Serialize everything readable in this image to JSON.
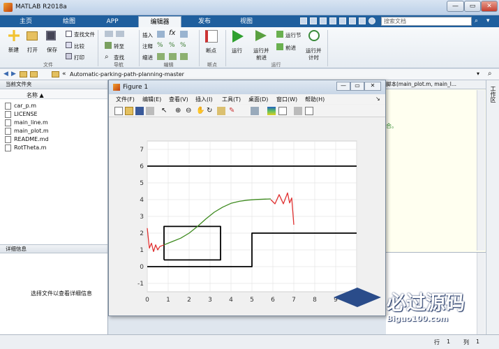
{
  "window": {
    "title": "MATLAB R2018a",
    "min": "—",
    "max": "▭",
    "close": "✕"
  },
  "tabs": [
    {
      "label": "主页"
    },
    {
      "label": "绘图"
    },
    {
      "label": "APP"
    },
    {
      "label": "编辑器"
    },
    {
      "label": "发布"
    },
    {
      "label": "视图"
    }
  ],
  "search": {
    "placeholder": "搜索文档"
  },
  "ribbon": {
    "new": "新建",
    "open": "打开",
    "save": "保存",
    "find_files": "查找文件",
    "compare": "比较",
    "print": "打印",
    "goto": "转至",
    "find": "查找",
    "insert": "插入",
    "comment": "注释",
    "indent": "缩进",
    "breakpoints": "断点",
    "run": "运行",
    "run_advance": "运行并",
    "run_advance2": "前进",
    "run_section": "运行节",
    "advance": "前进",
    "run_time": "运行并",
    "run_time2": "计时",
    "groups": {
      "file": "文件",
      "navigate": "导航",
      "edit": "编辑",
      "breakpoints": "断点",
      "run": "运行"
    }
  },
  "path": {
    "text": "Automatic-parking-path-planning-master"
  },
  "current_folder": {
    "title": "当前文件夹",
    "name_col": "名称 ▲",
    "files": [
      {
        "name": "car_p.m"
      },
      {
        "name": "LICENSE"
      },
      {
        "name": "main_line.m"
      },
      {
        "name": "main_plot.m"
      },
      {
        "name": "README.md"
      },
      {
        "name": "RotTheta.m"
      }
    ]
  },
  "details": {
    "title": "详细信息",
    "hint": "选择文件以查看详细信息"
  },
  "editor": {
    "tabs_text": "脚本(main_plot.m, main_l...",
    " snippet": "合。",
    "snippet": "合。"
  },
  "workspace_label": "工作区",
  "status": {
    "line_label": "行",
    "line": "1",
    "col_label": "列",
    "col": "1"
  },
  "figure": {
    "title": "Figure 1",
    "menu": [
      "文件(F)",
      "编辑(E)",
      "查看(V)",
      "插入(I)",
      "工具(T)",
      "桌面(D)",
      "窗口(W)",
      "帮助(H)"
    ]
  },
  "watermark": {
    "brand": "必过源码",
    "url": "Biguo100.com"
  },
  "chart_data": {
    "type": "line",
    "xlim": [
      0,
      10
    ],
    "ylim": [
      -1.5,
      7.5
    ],
    "x_ticks": [
      0,
      1,
      2,
      3,
      4,
      5,
      6,
      7,
      8,
      9,
      10
    ],
    "y_ticks": [
      -1,
      0,
      1,
      2,
      3,
      4,
      5,
      6,
      7
    ],
    "grid": true,
    "series": [
      {
        "color": "#000000",
        "x": [
          0,
          5,
          5,
          10
        ],
        "y": [
          0,
          0,
          2,
          2
        ]
      },
      {
        "color": "#000000",
        "x": [
          0,
          10
        ],
        "y": [
          6,
          6
        ]
      },
      {
        "color": "#000000",
        "x": [
          0.8,
          3.5,
          3.5,
          0.8,
          0.8
        ],
        "y": [
          0.4,
          0.4,
          2.4,
          2.4,
          0.4
        ]
      },
      {
        "color": "#e03030",
        "x": [
          0,
          0.1,
          0.2,
          0.3,
          0.4,
          0.5,
          0.6,
          0.8
        ],
        "y": [
          2.3,
          1.1,
          1.4,
          0.9,
          1.3,
          1.0,
          1.2,
          1.3
        ]
      },
      {
        "color": "#3d8a1e",
        "x": [
          0.8,
          1.2,
          1.6,
          2,
          2.4,
          2.8,
          3.2,
          3.6,
          4,
          4.4,
          4.8,
          5.2,
          5.6,
          5.9
        ],
        "y": [
          1.3,
          1.5,
          1.7,
          2.0,
          2.4,
          2.85,
          3.25,
          3.55,
          3.78,
          3.9,
          3.97,
          4.01,
          4.03,
          4.04
        ]
      },
      {
        "color": "#e03030",
        "x": [
          5.9,
          6.1,
          6.3,
          6.5,
          6.7,
          6.8,
          6.9,
          7.0
        ],
        "y": [
          4.0,
          3.75,
          4.3,
          3.75,
          4.4,
          3.8,
          4.1,
          2.5
        ]
      }
    ]
  }
}
